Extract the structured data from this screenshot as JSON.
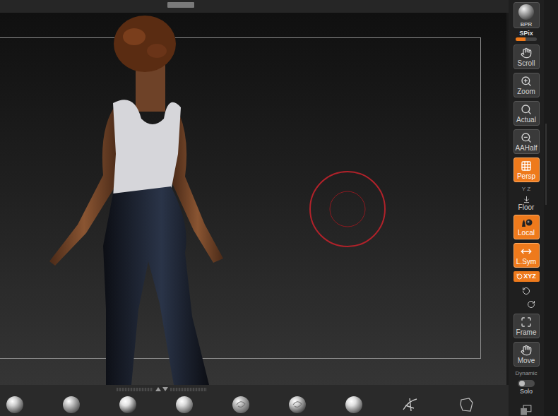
{
  "toolbar": {
    "render_button": {
      "label": "BPR"
    },
    "spix": {
      "label": "SPix",
      "level": 0.45
    },
    "items": [
      {
        "kind": "button",
        "label": "Scroll",
        "selected": false
      },
      {
        "kind": "button",
        "label": "Zoom",
        "selected": false
      },
      {
        "kind": "button",
        "label": "Actual",
        "selected": false
      },
      {
        "kind": "button",
        "label": "AAHalf",
        "selected": false
      },
      {
        "kind": "button",
        "label": "Persp",
        "selected": true
      },
      {
        "kind": "caption",
        "label": "Y Z"
      },
      {
        "kind": "flat",
        "label": "Floor",
        "selected": false
      },
      {
        "kind": "button",
        "label": "Local",
        "selected": true
      },
      {
        "kind": "button",
        "label": "L.Sym",
        "selected": true
      },
      {
        "kind": "small",
        "label": "XYZ",
        "selected": true
      },
      {
        "kind": "rotate"
      },
      {
        "kind": "button",
        "label": "Frame",
        "selected": false
      },
      {
        "kind": "button",
        "label": "Move",
        "selected": false
      },
      {
        "kind": "caption",
        "label": "Dynamic"
      },
      {
        "kind": "switch",
        "label": "Solo",
        "on": false
      }
    ]
  }
}
